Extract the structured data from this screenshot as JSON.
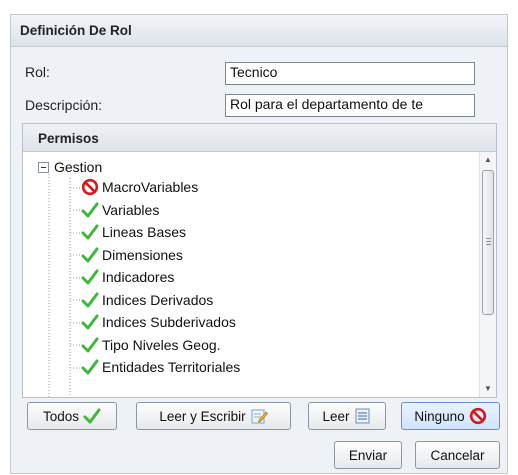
{
  "dialog": {
    "title": "Definición De Rol"
  },
  "form": {
    "rol_label": "Rol:",
    "rol_value": "Tecnico",
    "descripcion_label": "Descripción:",
    "descripcion_value": "Rol para el departamento de te"
  },
  "permisos": {
    "title": "Permisos",
    "root": {
      "label": "Gestion",
      "expanded": true
    },
    "items": [
      {
        "label": "MacroVariables",
        "icon": "no-access-icon"
      },
      {
        "label": "Variables",
        "icon": "check-icon"
      },
      {
        "label": "Lineas Bases",
        "icon": "check-icon"
      },
      {
        "label": "Dimensiones",
        "icon": "check-icon"
      },
      {
        "label": "Indicadores",
        "icon": "check-icon"
      },
      {
        "label": "Indices Derivados",
        "icon": "check-icon"
      },
      {
        "label": "Indices Subderivados",
        "icon": "check-icon"
      },
      {
        "label": "Tipo Niveles Geog.",
        "icon": "check-icon"
      },
      {
        "label": "Entidades Territoriales",
        "icon": "check-icon"
      }
    ]
  },
  "permission_buttons": {
    "todos": "Todos",
    "leer_escribir": "Leer y Escribir",
    "leer": "Leer",
    "ninguno": "Ninguno"
  },
  "actions": {
    "enviar": "Enviar",
    "cancelar": "Cancelar"
  },
  "colors": {
    "check": "#3fb83a",
    "no_access": "#d9161c"
  }
}
